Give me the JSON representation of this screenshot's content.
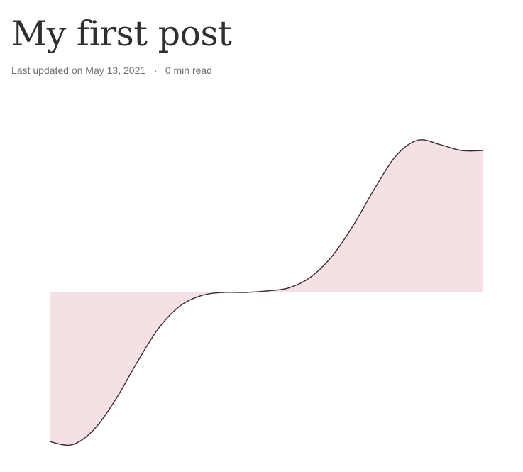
{
  "post": {
    "title": "My first post",
    "updated_label": "Last updated on May 13, 2021",
    "separator": "·",
    "read_time": "0 min read"
  },
  "colors": {
    "fill": "#f5e1e4",
    "line": "#3b2a32"
  },
  "chart_data": {
    "type": "area",
    "x": [
      0,
      0.05,
      0.1,
      0.15,
      0.2,
      0.25,
      0.3,
      0.35,
      0.4,
      0.45,
      0.5,
      0.55,
      0.6,
      0.65,
      0.7,
      0.75,
      0.8,
      0.85,
      0.9,
      0.95,
      1
    ],
    "y": [
      -1,
      -1.02,
      -0.92,
      -0.72,
      -0.47,
      -0.24,
      -0.09,
      -0.02,
      0,
      0,
      0.01,
      0.03,
      0.1,
      0.24,
      0.45,
      0.7,
      0.92,
      1.02,
      0.99,
      0.95,
      0.95
    ],
    "baseline": 0,
    "ylim": [
      -1.05,
      1.05
    ],
    "xlim": [
      0,
      1
    ],
    "grid": false,
    "legend": false
  }
}
